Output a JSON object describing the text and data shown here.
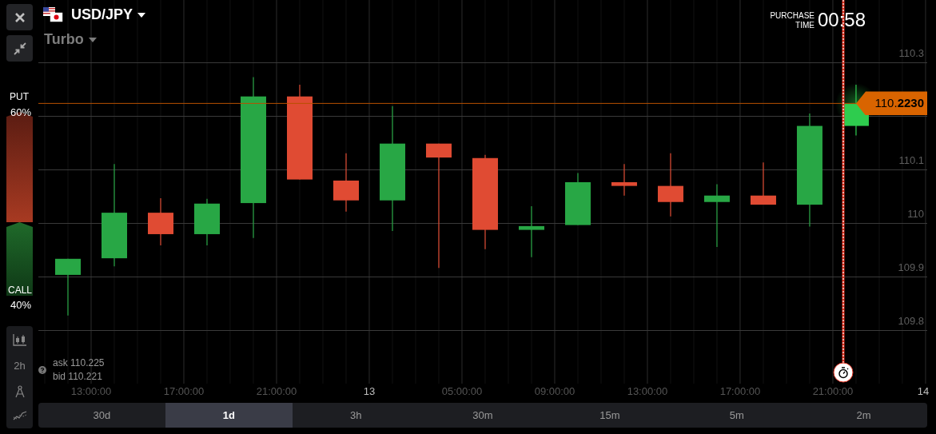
{
  "asset": {
    "pair": "USD/JPY",
    "mode": "Turbo"
  },
  "purchase_time": {
    "label": "PURCHASE",
    "label_2": "TIME",
    "value": "00:58"
  },
  "sentiment": {
    "put_label": "PUT",
    "put_value": "60%",
    "call_label": "CALL",
    "call_value": "40%",
    "level": 0.6
  },
  "chart": {
    "price_axis": [
      "110.3",
      "110.1",
      "110",
      "109.9",
      "109.8"
    ],
    "time_axis": [
      {
        "label": "13:00:00",
        "kind": "time"
      },
      {
        "label": "17:00:00",
        "kind": "time"
      },
      {
        "label": "21:00:00",
        "kind": "time"
      },
      {
        "label": "13",
        "kind": "day"
      },
      {
        "label": "05:00:00",
        "kind": "time"
      },
      {
        "label": "09:00:00",
        "kind": "time"
      },
      {
        "label": "13:00:00",
        "kind": "time"
      },
      {
        "label": "17:00:00",
        "kind": "time"
      },
      {
        "label": "21:00:00",
        "kind": "time"
      },
      {
        "label": "14",
        "kind": "day"
      }
    ],
    "current_price": "110.**2230**",
    "quote": {
      "ask": "ask 110.225",
      "bid": "bid 110.221"
    }
  },
  "tools": [
    {
      "kind": "candles"
    },
    {
      "kind": "interval",
      "label": "2h"
    },
    {
      "kind": "drawing"
    },
    {
      "kind": "indicators"
    }
  ],
  "timeframes": [
    {
      "label": "30d",
      "selected": false
    },
    {
      "label": "1d",
      "selected": true
    },
    {
      "label": "3h",
      "selected": false
    },
    {
      "label": "30m",
      "selected": false
    },
    {
      "label": "15m",
      "selected": false
    },
    {
      "label": "5m",
      "selected": false
    },
    {
      "label": "2m",
      "selected": false
    }
  ]
}
